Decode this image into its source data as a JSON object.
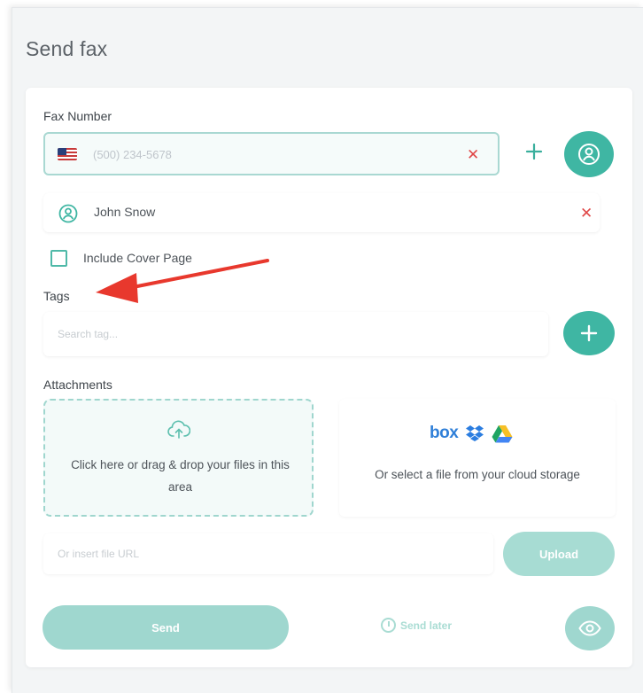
{
  "title": "Send fax",
  "fax_number": {
    "label": "Fax Number",
    "country_flag": "us-flag-icon",
    "placeholder": "(500) 234-5678",
    "clear_icon": "close-icon",
    "add_icon": "plus-icon",
    "contacts_icon": "user-icon"
  },
  "recipient": {
    "name": "John Snow",
    "icon": "user-circle-icon",
    "remove_icon": "close-icon"
  },
  "cover_page": {
    "label": "Include Cover Page",
    "checked": false
  },
  "tags": {
    "label": "Tags",
    "placeholder": "Search tag...",
    "add_icon": "plus-icon"
  },
  "attachments": {
    "label": "Attachments",
    "drop_text": "Click here or drag & drop your files in this area",
    "upload_icon": "cloud-upload-icon",
    "cloud_text": "Or select a file from your cloud storage",
    "cloud_services": [
      "box",
      "Dropbox",
      "Google Drive"
    ],
    "box_logo_text": "box",
    "url_placeholder": "Or insert file URL",
    "upload_button": "Upload"
  },
  "actions": {
    "send": "Send",
    "send_later": "Send later",
    "preview_icon": "eye-icon"
  },
  "colors": {
    "accent": "#3fb6a3",
    "accent_light": "#a7dcd3",
    "danger": "#e04848",
    "annotation_arrow": "#e8382d"
  }
}
